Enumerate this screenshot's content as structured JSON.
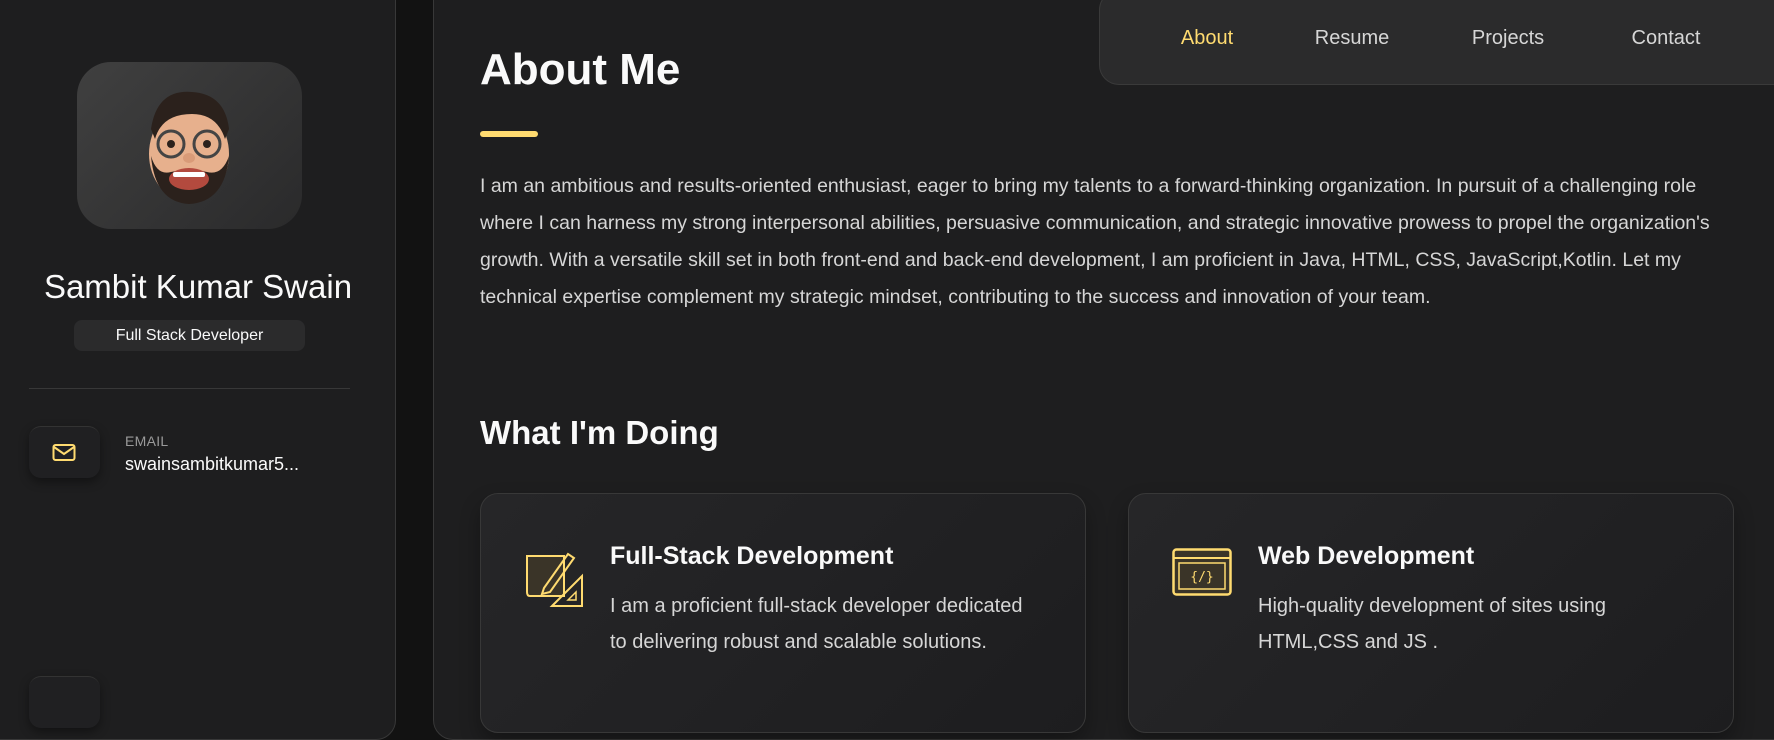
{
  "sidebar": {
    "name": "Sambit Kumar Swain",
    "title": "Full Stack Developer",
    "contacts": [
      {
        "label": "EMAIL",
        "value": "swainsambitkumar5...",
        "icon": "mail-icon"
      }
    ]
  },
  "nav": {
    "items": [
      "About",
      "Resume",
      "Projects",
      "Contact"
    ],
    "active": "About"
  },
  "about": {
    "title": "About Me",
    "text": "I am an ambitious and results-oriented enthusiast, eager to bring my talents to a forward-thinking organization. In pursuit of a challenging role where I can harness my strong interpersonal abilities, persuasive communication, and strategic innovative prowess to propel the organization's growth. With a versatile skill set in both front-end and back-end development, I am proficient in Java, HTML, CSS, JavaScript,Kotlin. Let my technical expertise complement my strategic mindset, contributing to the success and innovation of your team."
  },
  "services": {
    "title": "What I'm Doing",
    "items": [
      {
        "title": "Full-Stack Development",
        "text": "I am a proficient full-stack developer dedicated to delivering robust and scalable solutions.",
        "icon": "design-tools-icon"
      },
      {
        "title": "Web Development",
        "text": "High-quality development of sites using HTML,CSS and JS .",
        "icon": "code-window-icon"
      }
    ]
  },
  "colors": {
    "accent": "#ffdb70",
    "bg": "#1e1e1f"
  }
}
